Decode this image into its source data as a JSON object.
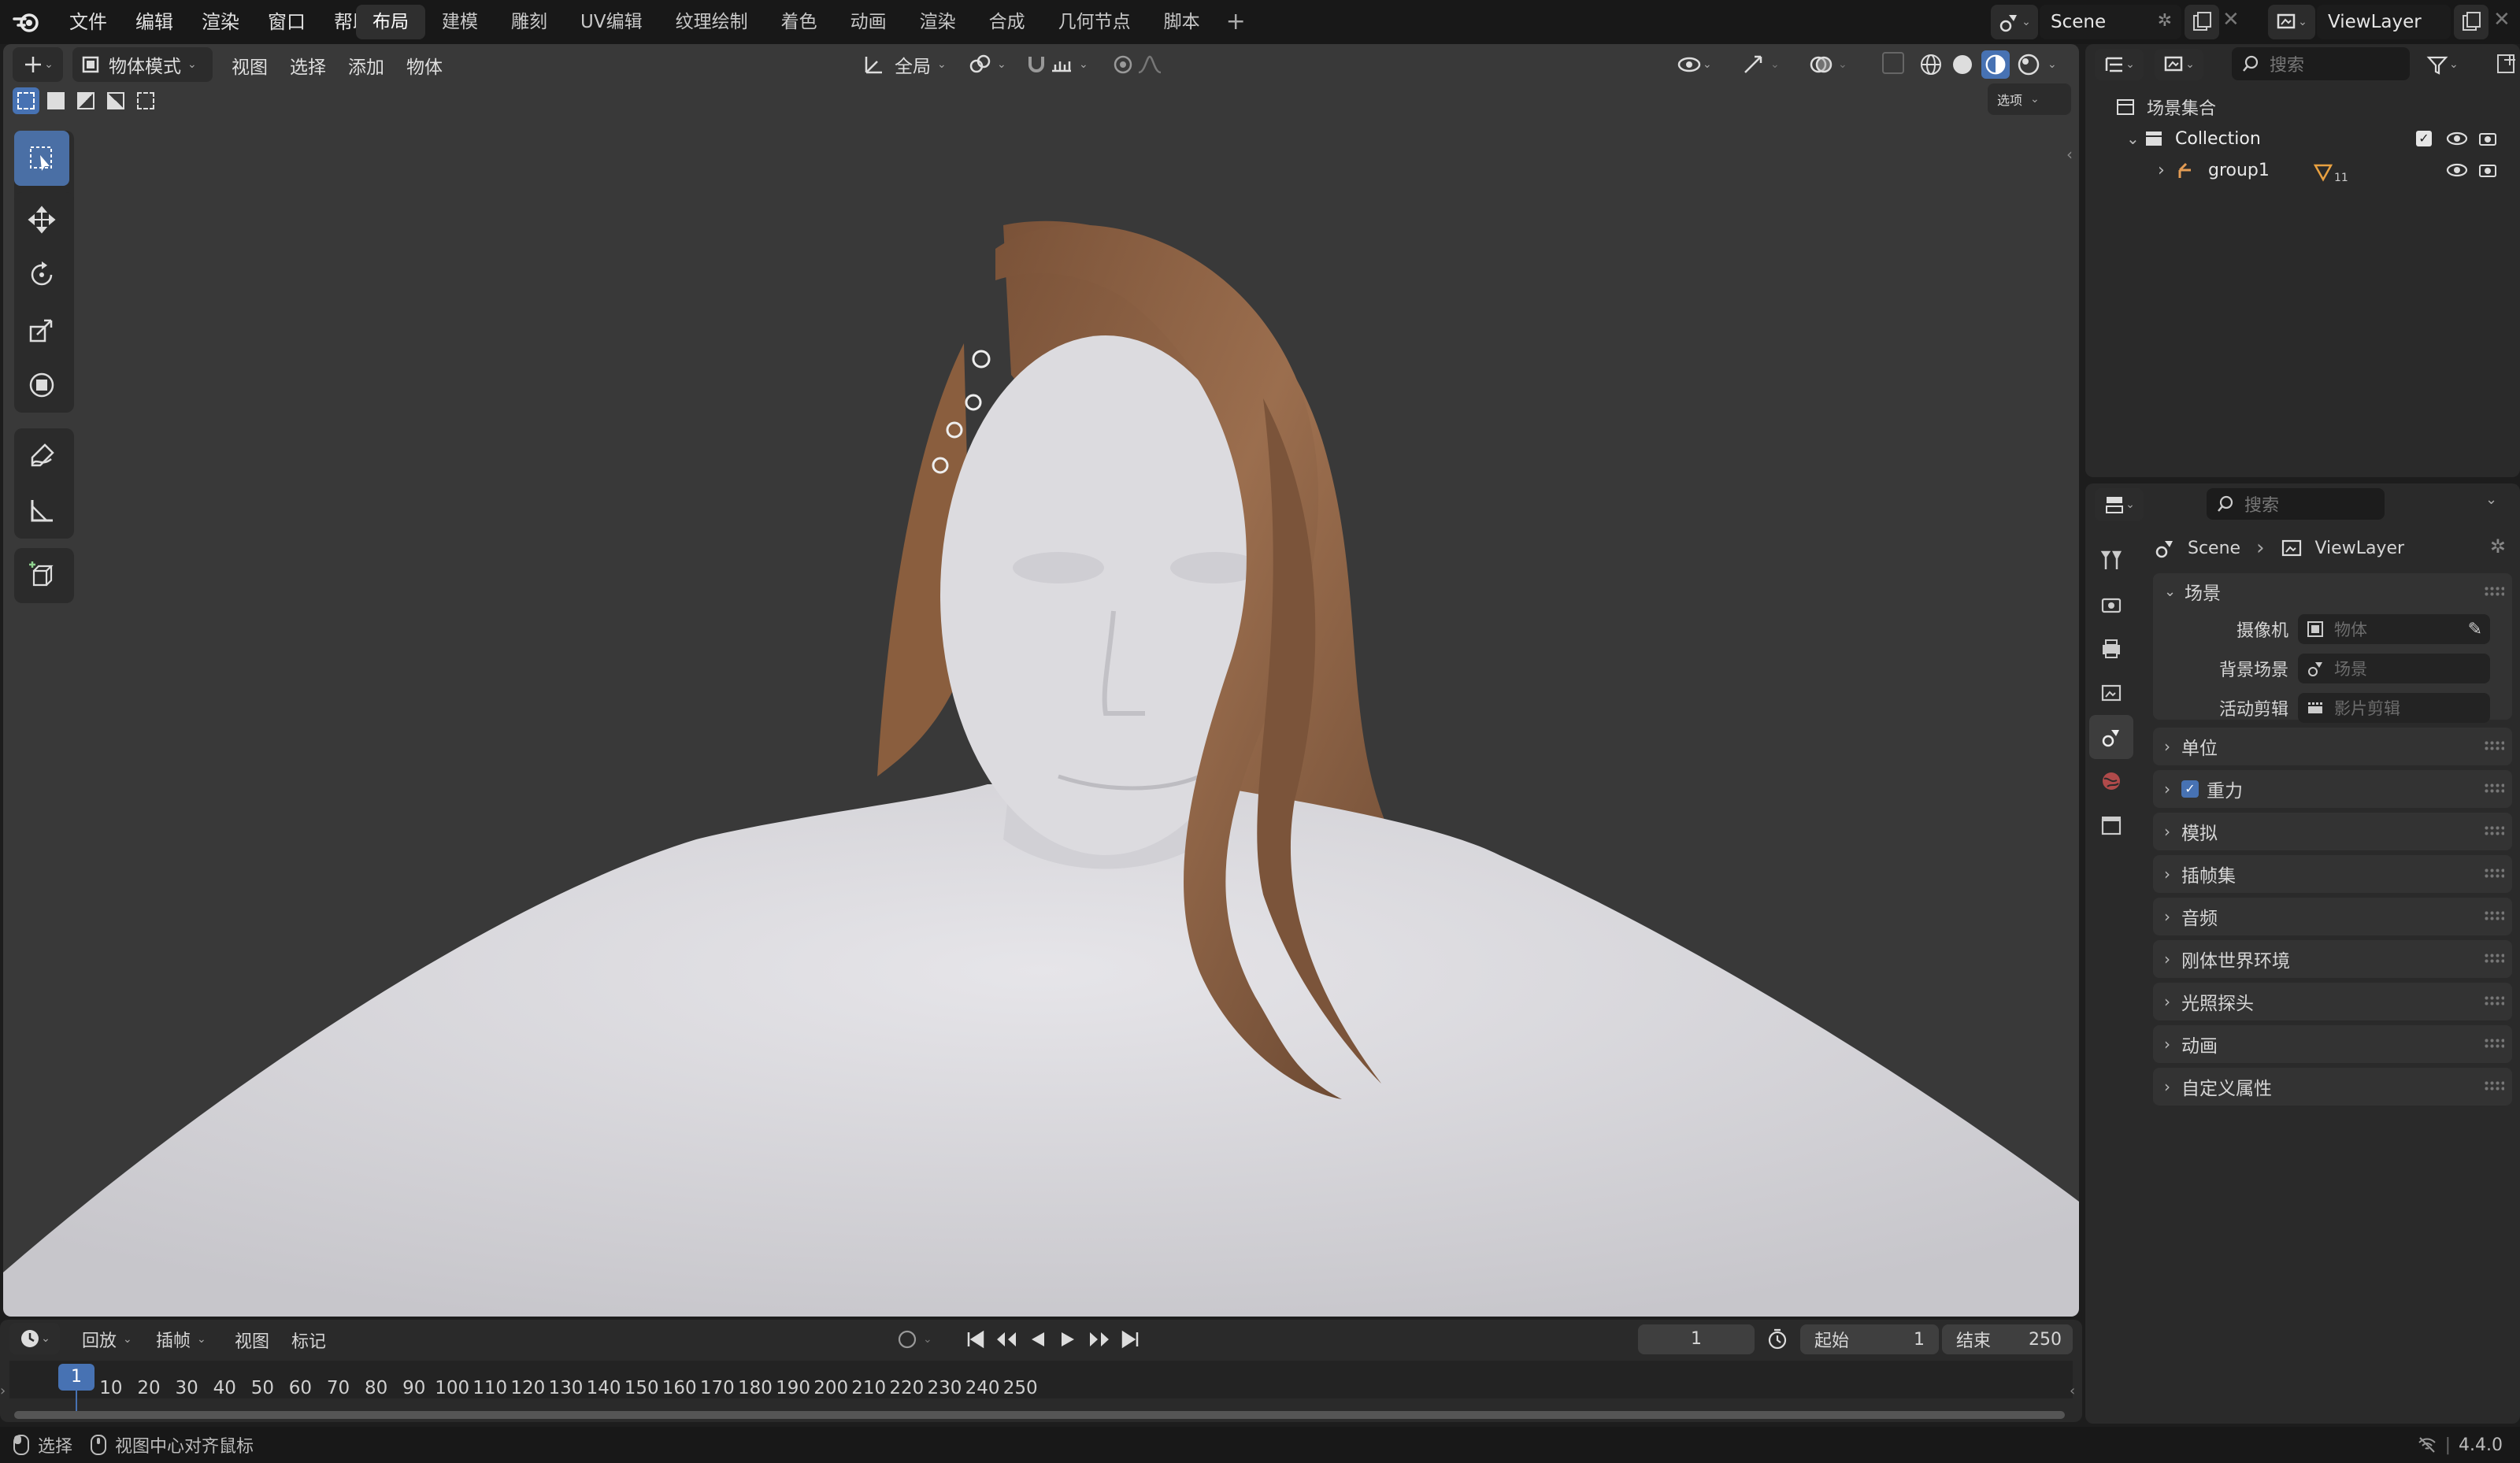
{
  "top_menu": {
    "items": [
      "文件",
      "编辑",
      "渲染",
      "窗口",
      "帮助"
    ],
    "workspaces": [
      "布局",
      "建模",
      "雕刻",
      "UV编辑",
      "纹理绘制",
      "着色",
      "动画",
      "渲染",
      "合成",
      "几何节点",
      "脚本"
    ],
    "active_workspace": "布局",
    "scene": "Scene",
    "view_layer": "ViewLayer"
  },
  "viewport": {
    "mode": "物体模式",
    "menus": [
      "视图",
      "选择",
      "添加",
      "物体"
    ],
    "transform_orientation": "全局",
    "options_label": "选项"
  },
  "outliner": {
    "search_placeholder": "搜索",
    "root": "场景集合",
    "collection": "Collection",
    "object": "group1",
    "object_badge": "11"
  },
  "properties": {
    "search_placeholder": "搜索",
    "breadcrumb_scene": "Scene",
    "breadcrumb_layer": "ViewLayer",
    "section_title": "场景",
    "fields": [
      {
        "label": "摄像机",
        "placeholder": "物体"
      },
      {
        "label": "背景场景",
        "placeholder": "场景"
      },
      {
        "label": "活动剪辑",
        "placeholder": "影片剪辑"
      }
    ],
    "panels": [
      "单位",
      "重力",
      "模拟",
      "插帧集",
      "音频",
      "刚体世界环境",
      "光照探头",
      "动画",
      "自定义属性"
    ],
    "gravity_checked": true
  },
  "timeline": {
    "menus": [
      "回放",
      "插帧",
      "视图",
      "标记"
    ],
    "current_frame": "1",
    "start_label": "起始",
    "start_value": "1",
    "end_label": "结束",
    "end_value": "250",
    "ticks": [
      "10",
      "20",
      "30",
      "40",
      "50",
      "60",
      "70",
      "80",
      "90",
      "100",
      "110",
      "120",
      "130",
      "140",
      "150",
      "160",
      "170",
      "180",
      "190",
      "200",
      "210",
      "220",
      "230",
      "240",
      "250"
    ],
    "playhead_label": "1"
  },
  "statusbar": {
    "select_label": "选择",
    "center_label": "视图中心对齐鼠标",
    "version": "4.4.0"
  },
  "colors": {
    "accent": "#4772b3",
    "hair": "#8a5e3e",
    "skin": "#d7d6da",
    "viewport_bg": "#393939"
  }
}
